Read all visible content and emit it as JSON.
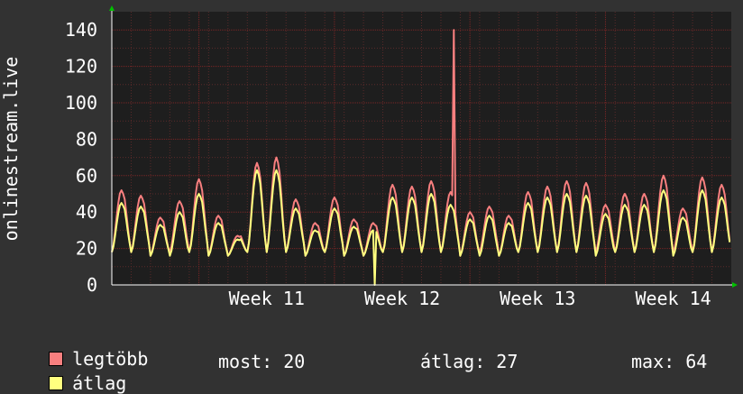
{
  "chart_data": {
    "type": "line",
    "ylabel": "onlinestream.live",
    "ylim": [
      0,
      150
    ],
    "yticks": [
      0,
      20,
      40,
      60,
      80,
      100,
      120,
      140
    ],
    "xticks": [
      "Week 11",
      "Week 12",
      "Week 13",
      "Week 14"
    ],
    "grid": true,
    "days": 32,
    "series": [
      {
        "name": "legtöbb",
        "color": "#f87f7f",
        "daily_peaks": [
          52,
          49,
          37,
          46,
          58,
          38,
          27,
          67,
          70,
          47,
          34,
          48,
          36,
          34,
          55,
          54,
          57,
          51,
          40,
          43,
          38,
          51,
          54,
          57,
          56,
          44,
          50,
          50,
          60,
          42,
          59,
          55
        ],
        "spikes": [
          {
            "day": 17.65,
            "value": 140
          }
        ]
      },
      {
        "name": "átlag",
        "color": "#ffff7f",
        "daily_peaks": [
          45,
          43,
          33,
          40,
          50,
          34,
          25,
          63,
          63,
          42,
          30,
          42,
          32,
          30,
          48,
          48,
          50,
          44,
          36,
          38,
          34,
          45,
          48,
          50,
          49,
          39,
          44,
          44,
          52,
          37,
          52,
          48
        ],
        "dips": [
          {
            "day": 13.55,
            "value": 0
          }
        ]
      }
    ],
    "legend": {
      "items": [
        {
          "label": "legtöbb",
          "color": "#f87f7f"
        },
        {
          "label": "átlag",
          "color": "#ffff7f"
        }
      ],
      "stats": [
        {
          "label": "most:",
          "value": "20"
        },
        {
          "label": "átlag:",
          "value": "27"
        },
        {
          "label": "max:",
          "value": "64"
        }
      ]
    }
  }
}
